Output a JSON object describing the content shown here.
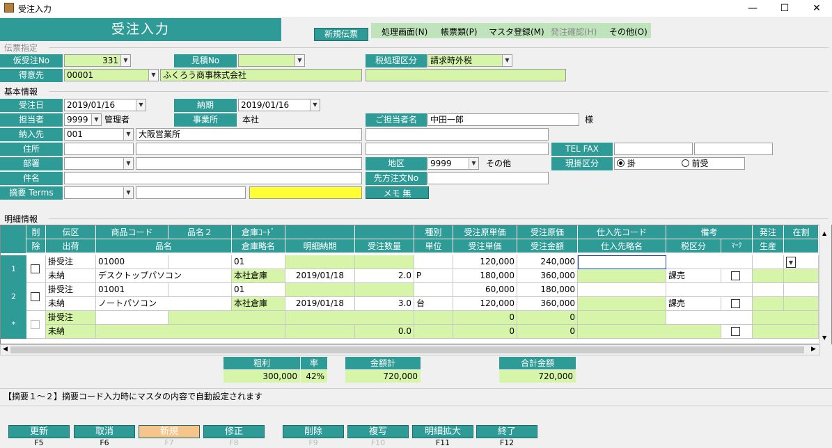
{
  "window": {
    "title": "受注入力",
    "minimize": "—",
    "maximize": "☐",
    "close": "✕"
  },
  "header": {
    "title": "受注入力",
    "new_label": "新規伝票"
  },
  "menu": [
    {
      "label": "処理画面(N)",
      "enabled": true
    },
    {
      "label": "帳票類(P)",
      "enabled": true
    },
    {
      "label": "マスタ登録(M)",
      "enabled": true
    },
    {
      "label": "発注確認(H)",
      "enabled": false
    },
    {
      "label": "その他(O)",
      "enabled": true
    }
  ],
  "sections": {
    "denpyo": "伝票指定",
    "kihon": "基本情報",
    "meisai": "明細情報"
  },
  "denpyo": {
    "kari_label": "仮受注No",
    "kari_value": "331",
    "mitsumori_label": "見積No",
    "mitsumori_value": "",
    "zei_label": "税処理区分",
    "zei_value": "請求時外税",
    "tokui_label": "得意先",
    "tokui_code": "00001",
    "tokui_name": "ふくろう商事株式会社",
    "tokui_extra": ""
  },
  "kihon": {
    "juchubi_label": "受注日",
    "juchubi": "2019/01/16",
    "nouki_label": "納期",
    "nouki": "2019/01/16",
    "tanto_label": "担当者",
    "tanto_code": "9999",
    "tanto_name": "管理者",
    "jigyo_label": "事業所",
    "jigyo_value": "本社",
    "gotanto_label": "ご担当者名",
    "gotanto_value": "中田一郎",
    "sama": "様",
    "nounyu_label": "納入先",
    "nounyu_code": "001",
    "nounyu_name": "大阪営業所",
    "jusho_label": "住所",
    "telfax_label": "TEL FAX",
    "busho_label": "部署",
    "chiku_label": "地区",
    "chiku_code": "9999",
    "chiku_name": "その他",
    "genkake_label": "現掛区分",
    "kake": "掛",
    "maeuke": "前受",
    "kenmei_label": "件名",
    "sakikata_label": "先方注文No",
    "tekiyo_label": "摘要 Terms",
    "memo_label": "メモ 無"
  },
  "grid": {
    "headers_top": [
      "削",
      "伝区",
      "商品コード",
      "品名２",
      "倉庫ｺｰﾄﾞ",
      "",
      "",
      "種別",
      "受注原単価",
      "受注原価",
      "仕入先コード",
      "備考",
      "発注",
      "在割"
    ],
    "headers_bottom": [
      "除",
      "出荷",
      "品名",
      "",
      "倉庫略名",
      "明細納期",
      "受注数量",
      "単位",
      "受注単価",
      "受注金額",
      "仕入先略名",
      "税区分",
      "ﾏｰｸ",
      "生産"
    ],
    "rows": [
      {
        "no": "1",
        "denku": "掛受注",
        "code": "01000",
        "hinmei2": "",
        "soko_code": "01",
        "genka_tanka": "120,000",
        "genka": "240,000",
        "shukka": "未納",
        "hinmei": "デスクトップパソコン",
        "soko_name": "本社倉庫",
        "nouki": "2019/01/18",
        "suryo": "2.0",
        "tani": "P",
        "tanka": "180,000",
        "kingaku": "360,000",
        "zei": "課売"
      },
      {
        "no": "2",
        "denku": "掛受注",
        "code": "01001",
        "hinmei2": "",
        "soko_code": "01",
        "genka_tanka": "60,000",
        "genka": "180,000",
        "shukka": "未納",
        "hinmei": "ノートパソコン",
        "soko_name": "本社倉庫",
        "nouki": "2019/01/18",
        "suryo": "3.0",
        "tani": "台",
        "tanka": "120,000",
        "kingaku": "360,000",
        "zei": "課売"
      },
      {
        "no": "*",
        "denku": "掛受注",
        "code": "",
        "hinmei2": "",
        "soko_code": "",
        "genka_tanka": "0",
        "genka": "0",
        "shukka": "未納",
        "hinmei": "",
        "soko_name": "",
        "nouki": "",
        "suryo": "0.0",
        "tani": "",
        "tanka": "0",
        "kingaku": "0",
        "zei": ""
      }
    ]
  },
  "summary": {
    "arari_label": "粗利",
    "arari": "300,000",
    "ritsu_label": "率",
    "ritsu": "42%",
    "kingakukei_label": "金額計",
    "kingakukei": "720,000",
    "gokei_label": "合計金額",
    "gokei": "720,000"
  },
  "message": "【摘要１～２】摘要コード入力時にマスタの内容で自動設定されます",
  "fkeys": [
    {
      "label": "更新",
      "key": "F5",
      "enabled": true
    },
    {
      "label": "取消",
      "key": "F6",
      "enabled": true
    },
    {
      "label": "新規",
      "key": "F7",
      "enabled": false
    },
    {
      "label": "修正",
      "key": "F8",
      "enabled": false
    },
    {
      "label": "削除",
      "key": "F9",
      "enabled": false
    },
    {
      "label": "複写",
      "key": "F10",
      "enabled": false
    },
    {
      "label": "明細拡大",
      "key": "F11",
      "enabled": true
    },
    {
      "label": "終了",
      "key": "F12",
      "enabled": true
    }
  ],
  "colors": {
    "accent": "#2f9b96",
    "field_green": "#d6f5a8",
    "field_yellow": "#ffff33"
  }
}
